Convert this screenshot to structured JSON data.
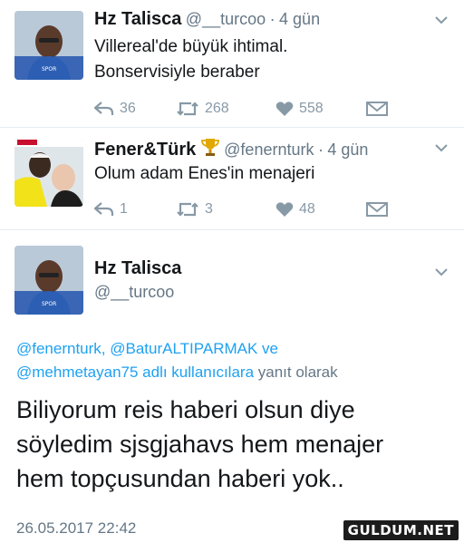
{
  "tweets": [
    {
      "name": "Hz Talisca",
      "handle": "@__turcoo",
      "dot": "·",
      "time": "4 gün",
      "text_lines": [
        "Villereal'de büyük ihtimal.",
        "Bonservisiyle beraber"
      ],
      "replies": "36",
      "retweets": "268",
      "likes": "558",
      "avatar_icon": "profile-photo"
    },
    {
      "name": "Fener&Türk",
      "name_icon": "trophy-icon",
      "handle": "@fenernturk",
      "dot": "·",
      "time": "4 gün",
      "text_lines": [
        "Olum adam Enes'in menajeri"
      ],
      "replies": "1",
      "retweets": "3",
      "likes": "48",
      "avatar_icon": "profile-photo"
    }
  ],
  "focused_tweet": {
    "name": "Hz Talisca",
    "handle": "@__turcoo",
    "reply_context": {
      "line1_mentions": "@fenernturk, @BaturALTIPARMAK",
      "line1_and": " ve",
      "line2_mention": "@mehmetayan75",
      "line2_suffix_blue": " adlı kullanıcılara",
      "line2_suffix_grey": " yanıt olarak"
    },
    "text_lines": [
      "Biliyorum reis haberi olsun diye",
      "söyledim sjsgjahavs hem menajer",
      "hem topçusundan haberi yok.."
    ],
    "timestamp": "26.05.2017 22:42"
  },
  "watermark": "GULDUM.NET",
  "colors": {
    "link": "#1da1f2",
    "secondary_text": "#657786",
    "icon_grey": "#8899a6"
  }
}
